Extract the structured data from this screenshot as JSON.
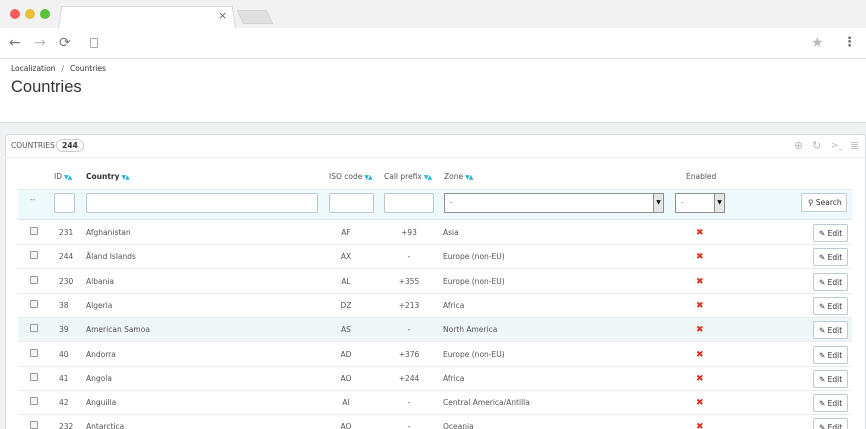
{
  "browser": {
    "tab_close": "×",
    "back_icon": "←",
    "forward_icon": "→",
    "reload_icon": "⟳",
    "star_icon": "★",
    "menu_icon": "⋮"
  },
  "breadcrumb": {
    "parent": "Localization",
    "separator": "/",
    "current": "Countries"
  },
  "page_title": "Countries",
  "panel": {
    "heading": "COUNTRIES",
    "count": "244"
  },
  "columns": {
    "id": "ID",
    "country": "Country",
    "iso": "ISO code",
    "call_prefix": "Call prefix",
    "zone": "Zone",
    "enabled": "Enabled"
  },
  "filters": {
    "bulk_placeholder": "--",
    "zone_selected": "-",
    "enabled_selected": "-",
    "search_label": "Search"
  },
  "edit_label": "Edit",
  "enabled_icon": "✖",
  "rows": [
    {
      "id": "231",
      "country": "Afghanistan",
      "iso": "AF",
      "prefix": "+93",
      "zone": "Asia"
    },
    {
      "id": "244",
      "country": "Åland Islands",
      "iso": "AX",
      "prefix": "-",
      "zone": "Europe (non-EU)"
    },
    {
      "id": "230",
      "country": "Albania",
      "iso": "AL",
      "prefix": "+355",
      "zone": "Europe (non-EU)"
    },
    {
      "id": "38",
      "country": "Algeria",
      "iso": "DZ",
      "prefix": "+213",
      "zone": "Africa"
    },
    {
      "id": "39",
      "country": "American Samoa",
      "iso": "AS",
      "prefix": "-",
      "zone": "North America"
    },
    {
      "id": "40",
      "country": "Andorra",
      "iso": "AD",
      "prefix": "+376",
      "zone": "Europe (non-EU)"
    },
    {
      "id": "41",
      "country": "Angola",
      "iso": "AO",
      "prefix": "+244",
      "zone": "Africa"
    },
    {
      "id": "42",
      "country": "Anguilla",
      "iso": "AI",
      "prefix": "-",
      "zone": "Central America/Antilla"
    },
    {
      "id": "232",
      "country": "Antarctica",
      "iso": "AQ",
      "prefix": "-",
      "zone": "Oceania"
    }
  ]
}
